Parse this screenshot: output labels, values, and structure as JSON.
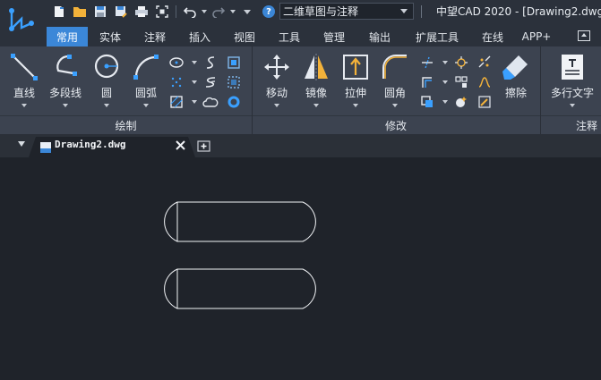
{
  "app": {
    "window_title": "中望CAD 2020 - [Drawing2.dwg]",
    "workspace": "二维草图与注释",
    "help_glyph": "?"
  },
  "quick_access": [
    {
      "icon": "new-file-icon"
    },
    {
      "icon": "open-folder-icon"
    },
    {
      "icon": "save-icon"
    },
    {
      "icon": "save-as-icon"
    },
    {
      "icon": "print-icon"
    },
    {
      "icon": "fit-view-icon"
    },
    {
      "icon": "undo-icon"
    },
    {
      "icon": "redo-icon"
    },
    {
      "icon": "customize-icon"
    }
  ],
  "ribbon_tabs": [
    "常用",
    "实体",
    "注释",
    "插入",
    "视图",
    "工具",
    "管理",
    "输出",
    "扩展工具",
    "在线",
    "APP+"
  ],
  "active_tab": "常用",
  "panels": {
    "draw": {
      "label": "绘制",
      "tools": [
        "直线",
        "多段线",
        "圆",
        "圆弧"
      ]
    },
    "modify": {
      "label": "修改",
      "tools": [
        "移动",
        "镜像",
        "拉伸",
        "圆角",
        "擦除"
      ]
    },
    "annotate": {
      "label": "注释",
      "tools": [
        "多行文字"
      ]
    }
  },
  "document": {
    "tab_name": "Drawing2.dwg"
  },
  "colors": {
    "accent": "#3b87d8",
    "ribbon": "#3c4350",
    "canvas": "#1f232a",
    "titlebar": "#2b313b"
  }
}
